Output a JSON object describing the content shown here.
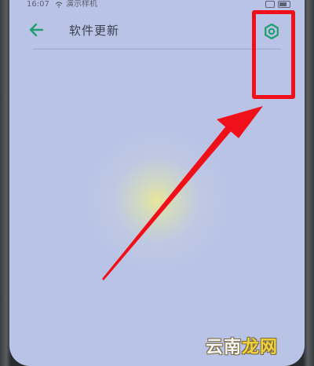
{
  "status_bar": {
    "time": "16:07",
    "carrier": "演示样机",
    "wifi_icon": "wifi-icon",
    "vibrate_icon": "vibrate-icon",
    "battery_icon": "battery-icon"
  },
  "app_bar": {
    "back_icon": "back-arrow-icon",
    "title": "软件更新",
    "settings_icon": "settings-gear-icon"
  },
  "annotation": {
    "highlight_color": "#f0101a",
    "arrow_color": "#f0101a"
  },
  "watermark": {
    "part1": "云南",
    "part2": "龙网"
  },
  "colors": {
    "screen_background": "#b9c3e6",
    "accent_green": "#1f9e6e"
  }
}
